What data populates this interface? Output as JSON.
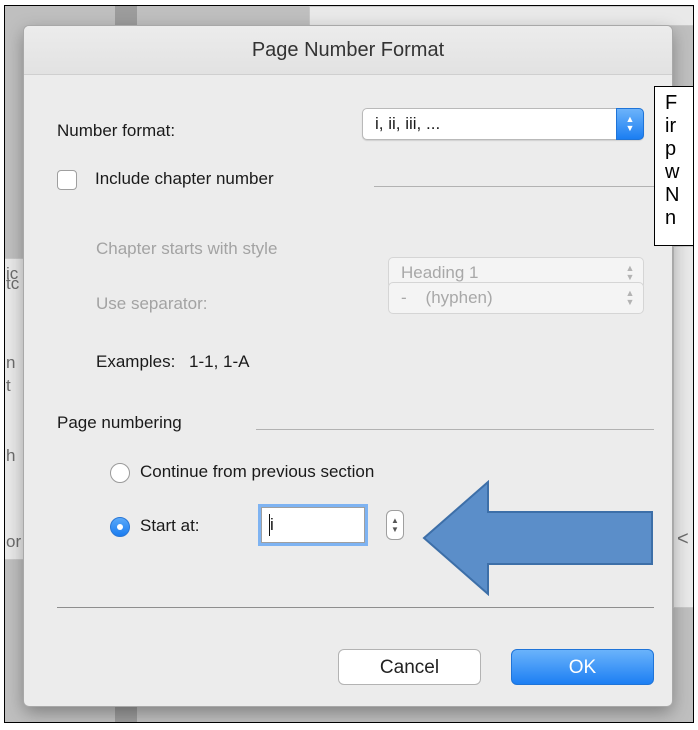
{
  "dialog": {
    "title": "Page Number Format",
    "number_format": {
      "label": "Number format:",
      "value": "i, ii, iii, ..."
    },
    "include_chapter": {
      "label": "Include chapter number",
      "checked": false
    },
    "chapter_style": {
      "label": "Chapter starts with style",
      "value": "Heading 1"
    },
    "separator": {
      "label": "Use separator:",
      "value": "-    (hyphen)"
    },
    "examples": {
      "label": "Examples:",
      "value": "1-1, 1-A"
    },
    "page_numbering": {
      "label": "Page numbering",
      "options": [
        {
          "label": "Continue from previous section",
          "selected": false
        },
        {
          "label": "Start at:",
          "selected": true
        }
      ],
      "start_at_value": "i"
    },
    "buttons": {
      "cancel": "Cancel",
      "ok": "OK"
    }
  },
  "callout": {
    "lines": [
      "F",
      "ir",
      "p",
      "w",
      "N",
      "n"
    ]
  },
  "background_fragments": [
    "ic",
    "tc",
    "n",
    "t",
    "h",
    "or",
    "<"
  ],
  "colors": {
    "accent": "#1d7ff3",
    "arrow": "#5b8ec9"
  }
}
